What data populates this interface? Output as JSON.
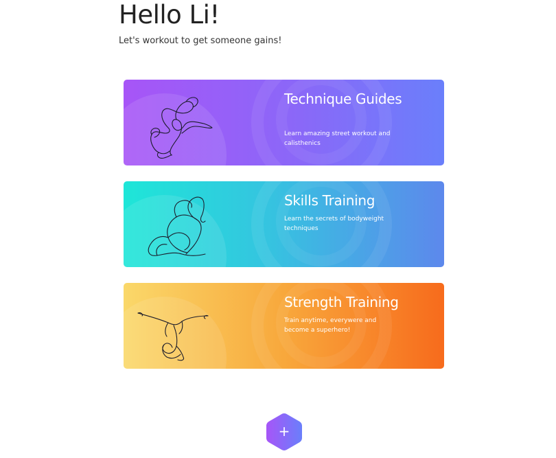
{
  "header": {
    "greeting": "Hello Li!",
    "subtitle": "Let's workout to get someone gains!"
  },
  "cards": [
    {
      "title": "Technique Guides",
      "description": "Learn amazing street workout and calisthenics",
      "illustration": "crow-pose-line-art",
      "gradient": [
        "#a755f7",
        "#6a7ffb"
      ]
    },
    {
      "title": "Skills Training",
      "description": "Learn the secrets of bodyweight techniques",
      "illustration": "seated-stretch-line-art",
      "gradient": [
        "#1ee6d8",
        "#5d88ec"
      ]
    },
    {
      "title": "Strength Training",
      "description": "Train anytime, everywere and become a superhero!",
      "illustration": "forearm-stand-split-line-art",
      "gradient": [
        "#fad86a",
        "#f76b1c"
      ]
    }
  ],
  "fab": {
    "icon": "plus-icon",
    "label": "+",
    "gradient": [
      "#a755f7",
      "#6a7ffb"
    ]
  }
}
